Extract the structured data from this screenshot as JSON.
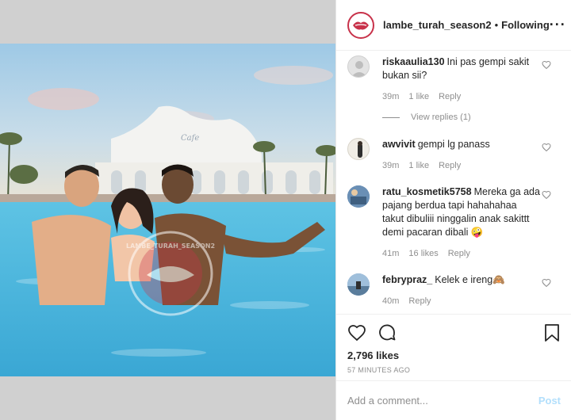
{
  "post": {
    "username": "lambe_turah_season2",
    "separator": "•",
    "follow_status": "Following",
    "more_icon": "more-horizontal-icon",
    "watermark_text": "LAMBE_TURAH_SEASON2"
  },
  "comments": [
    {
      "username": "riskaaulia130",
      "text": "Ini pas gempi sakit bukan sii?",
      "time": "39m",
      "likes": "1 like",
      "reply_label": "Reply",
      "view_replies": "View replies (1)",
      "avatar_color": "#e3e3e3"
    },
    {
      "username": "awvivit",
      "text": "gempi lg panass",
      "time": "39m",
      "likes": "1 like",
      "reply_label": "Reply",
      "avatar_color": "#f0ede6"
    },
    {
      "username": "ratu_kosmetik5758",
      "text": "Mereka ga ada pajang berdua tapi hahahahaa takut dibuliii ninggalin anak sakittt demi pacaran dibali 🤪",
      "time": "41m",
      "likes": "16 likes",
      "reply_label": "Reply",
      "avatar_color": "#6a8fb5"
    },
    {
      "username": "febrypraz_",
      "text": "Kelek e ireng🙈",
      "time": "40m",
      "likes": "",
      "reply_label": "Reply",
      "avatar_color": "#8aa9c9"
    }
  ],
  "actions": {
    "likes_count": "2,796 likes",
    "time_ago": "57 MINUTES AGO",
    "like_icon": "heart-icon",
    "comment_icon": "comment-icon",
    "save_icon": "bookmark-icon"
  },
  "composer": {
    "placeholder": "Add a comment...",
    "post_label": "Post"
  },
  "colors": {
    "brand_ring": "#c8324a",
    "post_disabled": "#b2dffc",
    "muted_text": "#8e8e8e"
  }
}
